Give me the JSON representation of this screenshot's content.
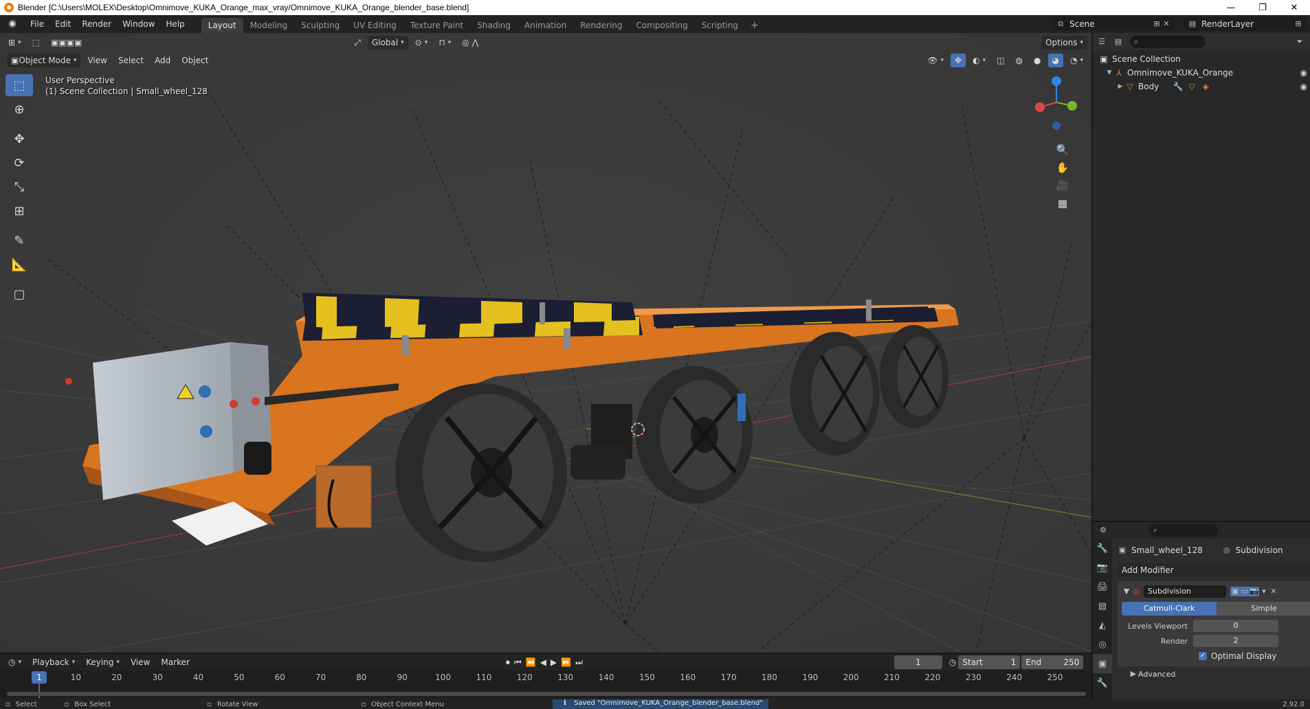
{
  "window": {
    "title": "Blender [C:\\Users\\MOLEX\\Desktop\\Omnimove_KUKA_Orange_max_vray/Omnimove_KUKA_Orange_blender_base.blend]",
    "minimize": "—",
    "restore": "❐",
    "close": "✕"
  },
  "menu": [
    "File",
    "Edit",
    "Render",
    "Window",
    "Help"
  ],
  "workspaces": [
    {
      "label": "Layout",
      "active": true
    },
    {
      "label": "Modeling"
    },
    {
      "label": "Sculpting"
    },
    {
      "label": "UV Editing"
    },
    {
      "label": "Texture Paint"
    },
    {
      "label": "Shading"
    },
    {
      "label": "Animation"
    },
    {
      "label": "Rendering"
    },
    {
      "label": "Compositing"
    },
    {
      "label": "Scripting"
    }
  ],
  "scene": {
    "name": "Scene",
    "view_layer": "RenderLayer"
  },
  "viewport": {
    "transform_orientation": "Global",
    "options_label": "Options",
    "mode": "Object Mode",
    "menus": [
      "View",
      "Select",
      "Add",
      "Object"
    ],
    "overlay_line1": "User Perspective",
    "overlay_line2": "(1) Scene Collection | Small_wheel_128"
  },
  "outliner": {
    "root": "Scene Collection",
    "items": [
      {
        "label": "Omnimove_KUKA_Orange",
        "depth": 1
      },
      {
        "label": "Body",
        "depth": 2
      }
    ]
  },
  "properties": {
    "object_name": "Small_wheel_128",
    "modifier_tab_name": "Subdivision",
    "add_modifier_label": "Add Modifier",
    "modifier": {
      "name": "Subdivision",
      "type_options": [
        "Catmull-Clark",
        "Simple"
      ],
      "selected_type": "Catmull-Clark",
      "levels_viewport_label": "Levels Viewport",
      "levels_viewport": "0",
      "render_label": "Render",
      "render": "2",
      "optimal_display_label": "Optimal Display",
      "optimal_display": true,
      "advanced_label": "Advanced"
    },
    "version_hint": "2.92.0"
  },
  "timeline": {
    "menus": [
      "Playback",
      "Keying",
      "View",
      "Marker"
    ],
    "current_frame": "1",
    "start_label": "Start",
    "start": "1",
    "end_label": "End",
    "end": "250",
    "ruler_ticks": [
      "1",
      "10",
      "20",
      "30",
      "40",
      "50",
      "60",
      "70",
      "80",
      "90",
      "100",
      "110",
      "120",
      "130",
      "140",
      "150",
      "160",
      "170",
      "180",
      "190",
      "200",
      "210",
      "220",
      "230",
      "240",
      "250"
    ]
  },
  "statusbar": {
    "items": [
      "Select",
      "Box Select",
      "Rotate View",
      "Object Context Menu"
    ],
    "message": "Saved \"Omnimove_KUKA_Orange_blender_base.blend\""
  },
  "colors": {
    "accent": "#4772b3",
    "robot_orange": "#e8822b",
    "axis_x": "#e04646",
    "axis_y": "#79b531",
    "axis_z": "#2f86e6"
  }
}
